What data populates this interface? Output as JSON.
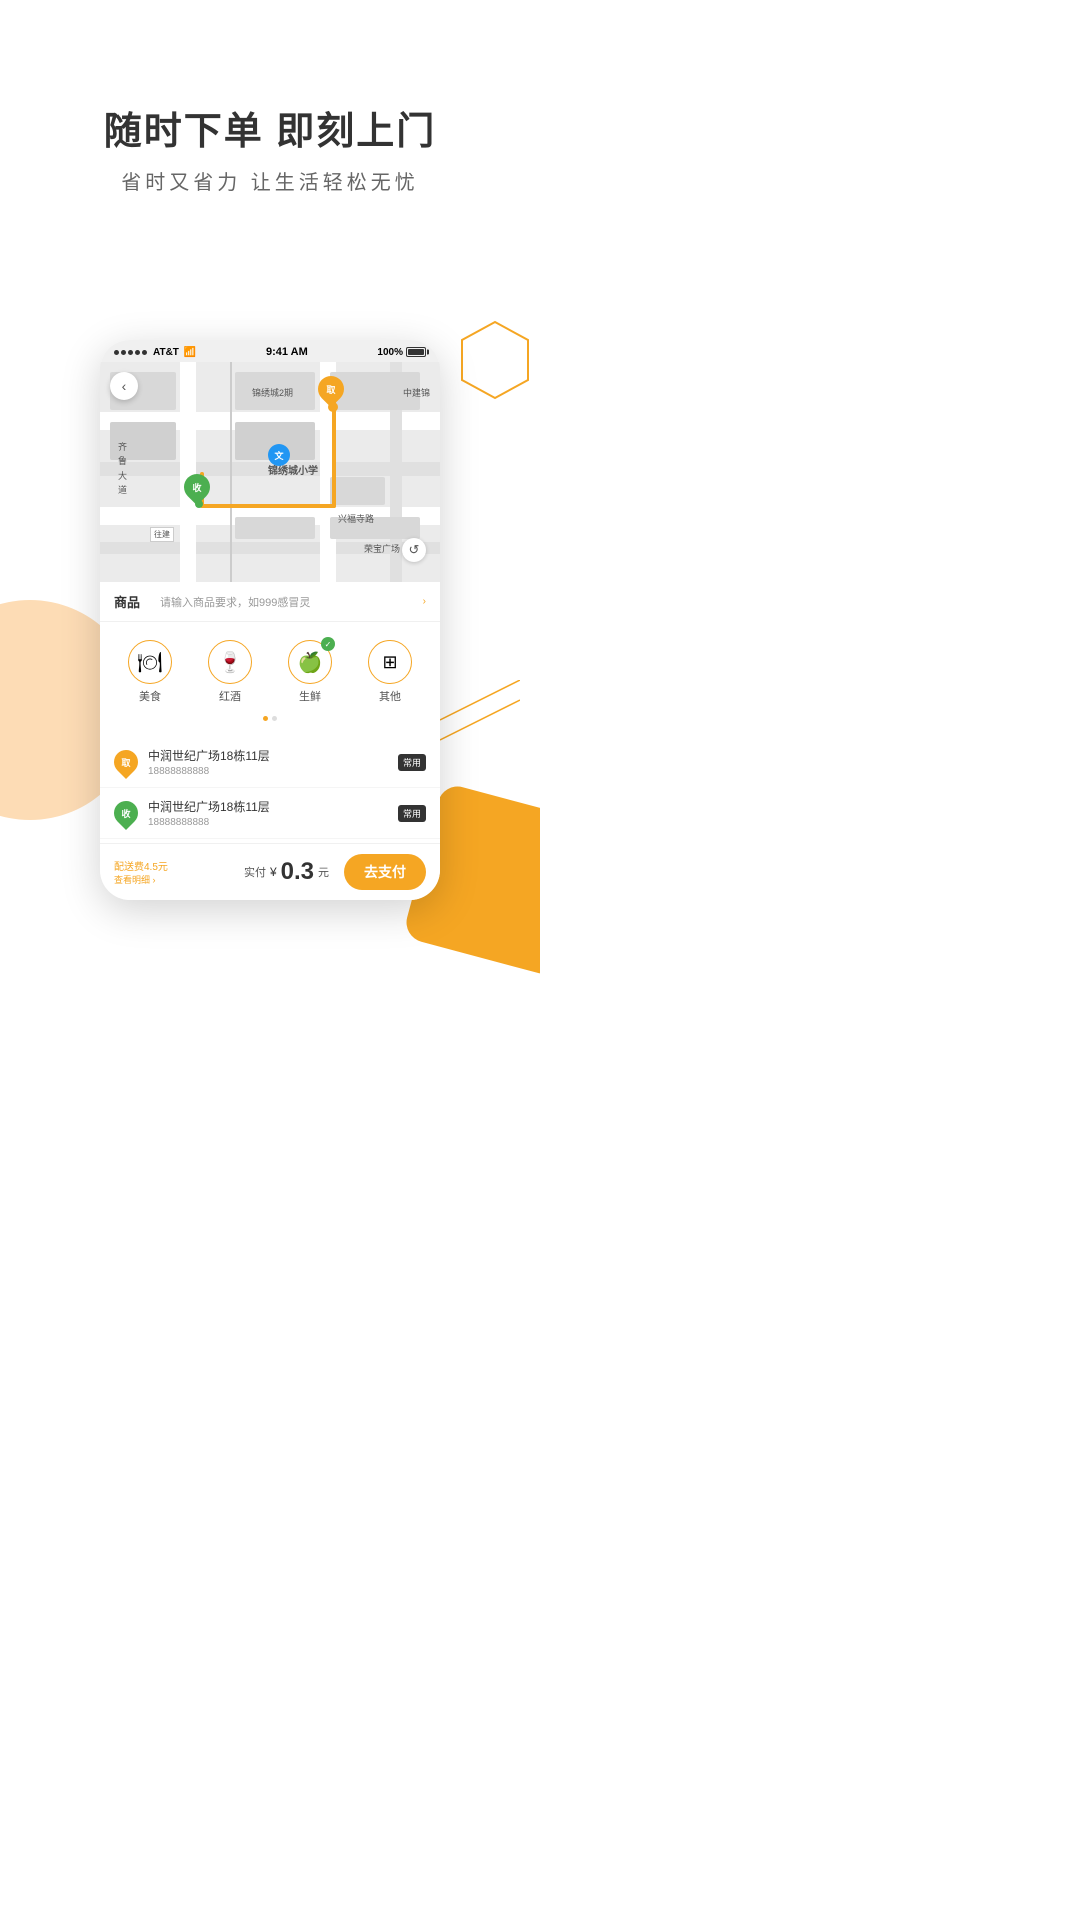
{
  "hero": {
    "title": "随时下单 即刻上门",
    "subtitle": "省时又省力   让生活轻松无忧"
  },
  "statusBar": {
    "carrier": "AT&T",
    "wifi": "WiFi",
    "time": "9:41 AM",
    "battery": "100%"
  },
  "map": {
    "pickupLabel": "取",
    "deliveryLabel": "收",
    "schoolLabel": "文",
    "schoolName": "锦绣城小学",
    "area1": "锦绣城2期",
    "road1": "齐鲁大道",
    "road2": "兴福寺路",
    "area2": "荣宝广场",
    "backLabel": "‹",
    "refreshLabel": "↺",
    "road3": "中建锦"
  },
  "product": {
    "label": "商品",
    "hint": "请输入商品要求，如999感冒灵",
    "hintArrow": "›"
  },
  "categories": [
    {
      "icon": "🍽",
      "label": "美食",
      "checked": false
    },
    {
      "icon": "🍷",
      "label": "红酒",
      "checked": false
    },
    {
      "icon": "🍏",
      "label": "生鲜",
      "checked": true
    },
    {
      "icon": "⊞",
      "label": "其他",
      "checked": false
    }
  ],
  "addresses": [
    {
      "type": "qu",
      "typeLabel": "取",
      "name": "中润世纪广场18栋11层",
      "phone": "18888888888",
      "tag": "常用"
    },
    {
      "type": "shou",
      "typeLabel": "收",
      "name": "中润世纪广场18栋11层",
      "phone": "18888888888",
      "tag": "常用"
    }
  ],
  "bottomBar": {
    "feeLabel": "配送费4.5元",
    "feeDetail": "查看明细 ›",
    "payLabel": "实付",
    "payCurrency": "¥",
    "payAmount": "0.3",
    "payUnit": "元",
    "payButton": "去支付"
  }
}
